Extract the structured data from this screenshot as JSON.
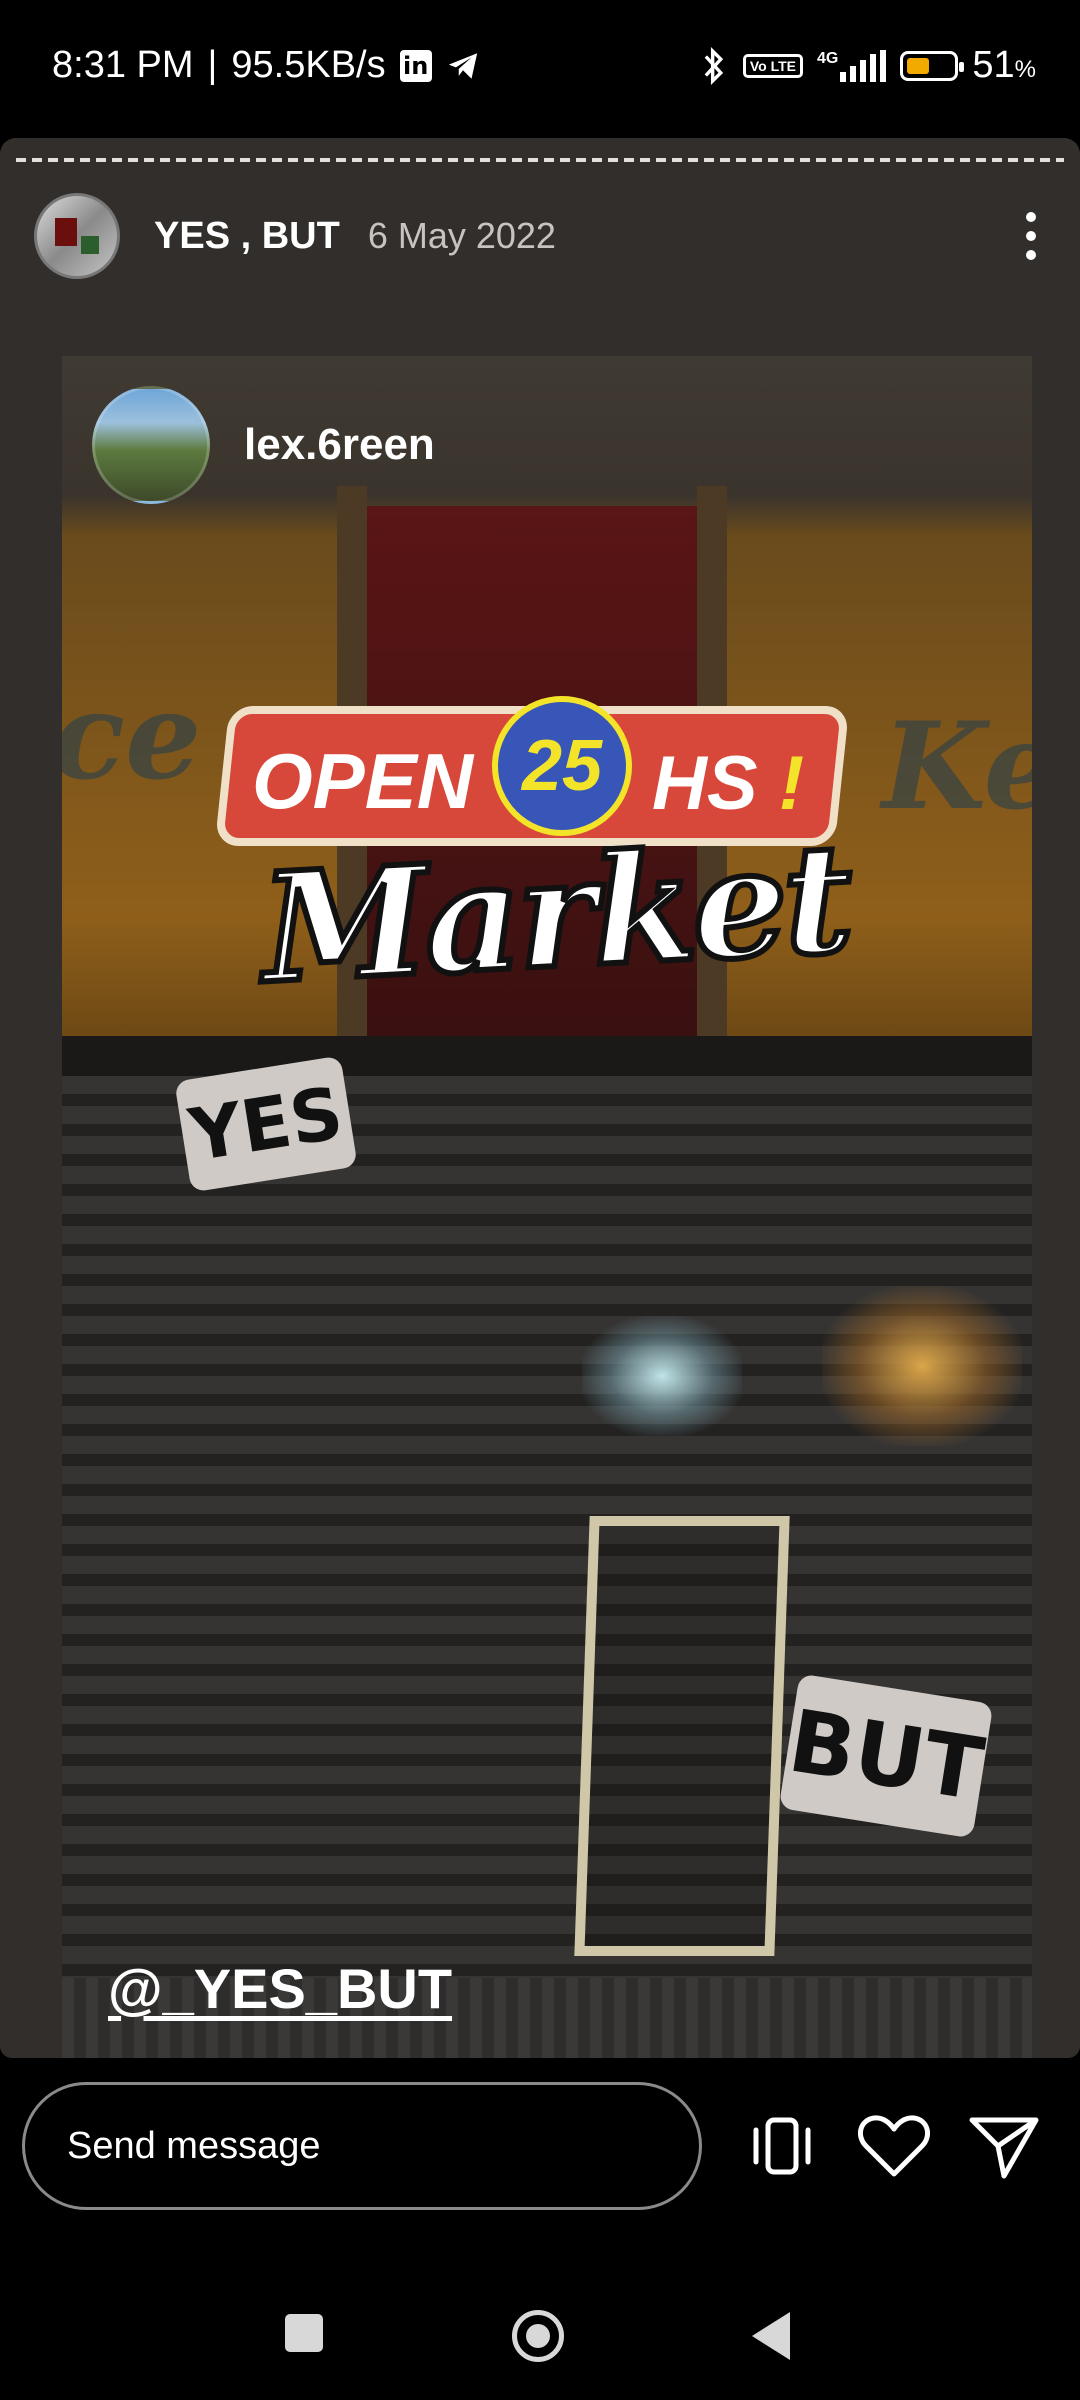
{
  "status_bar": {
    "time": "8:31 PM",
    "separator": "|",
    "speed": "95.5KB/s",
    "linkedin_icon": "linkedin-icon",
    "telegram_icon": "telegram-icon",
    "bluetooth_icon": "bluetooth-icon",
    "volte_label": "Vo LTE",
    "network_label": "4G",
    "battery_percent": "51",
    "percent_sign": "%"
  },
  "story_header": {
    "username": "YES , BUT",
    "date": "6 May 2022",
    "more_icon": "more-vertical-icon"
  },
  "story": {
    "shared_username": "lex.6reen",
    "sign_open": "OPEN",
    "sign_number": "25",
    "sign_hs": "HS",
    "sign_exclaim": "!",
    "sign_market": "Market",
    "sticker_yes": "YES",
    "sticker_but": "BUT",
    "mention": "@_YES_BUT"
  },
  "bottom_bar": {
    "message_placeholder": "Send message",
    "icons": [
      "vibrate-phone-icon",
      "heart-icon",
      "send-icon"
    ]
  },
  "colors": {
    "story_background": "#322e2b",
    "sticker_background": "#cfcac6",
    "battery_fill": "#f2a900",
    "sign_red": "#d8483a",
    "sign_blue": "#3756b8",
    "sign_yellow": "#f3e42a"
  }
}
